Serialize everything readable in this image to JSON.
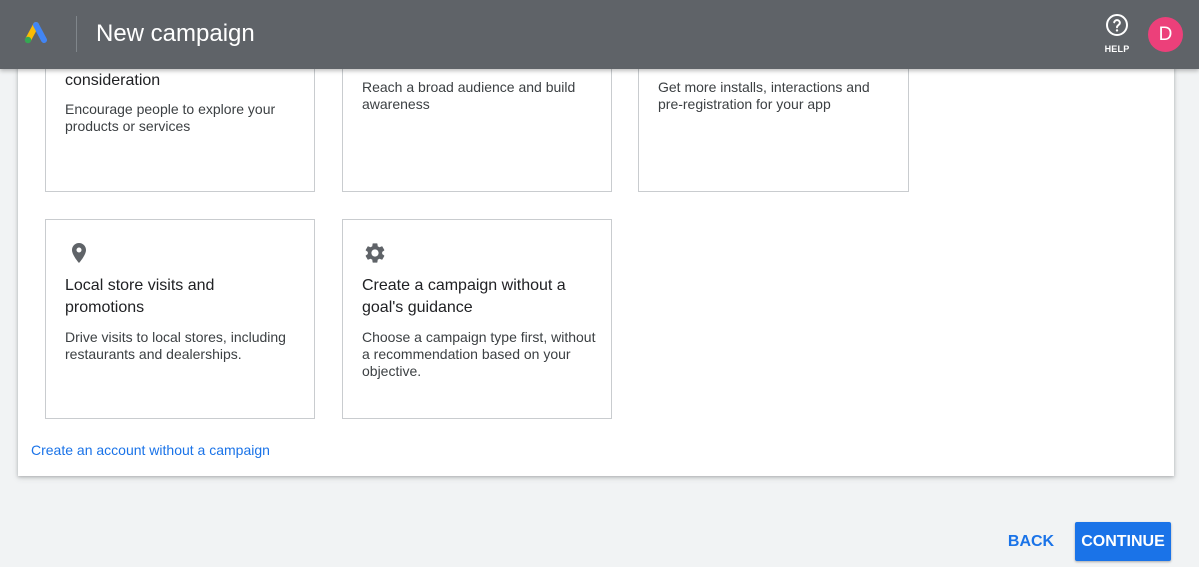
{
  "header": {
    "title": "New campaign",
    "help_label": "HELP",
    "avatar_initial": "D",
    "avatar_color": "#ec407a",
    "bar_color": "#5f6368"
  },
  "goals": [
    {
      "title": "consideration",
      "description": "Encourage people to explore your products or services"
    },
    {
      "title": "",
      "description": "Reach a broad audience and build awareness"
    },
    {
      "title": "",
      "description": "Get more installs, interactions and pre-registration for your app"
    },
    {
      "icon": "location-pin-icon",
      "title": "Local store visits and promotions",
      "description": "Drive visits to local stores, including restaurants and dealerships."
    },
    {
      "icon": "gear-icon",
      "title": "Create a campaign without a goal's guidance",
      "description": "Choose a campaign type first, without a recommendation based on your objective."
    }
  ],
  "links": {
    "no_campaign": "Create an account without a campaign"
  },
  "footer": {
    "back_label": "BACK",
    "continue_label": "CONTINUE",
    "accent_color": "#1a73e8"
  }
}
